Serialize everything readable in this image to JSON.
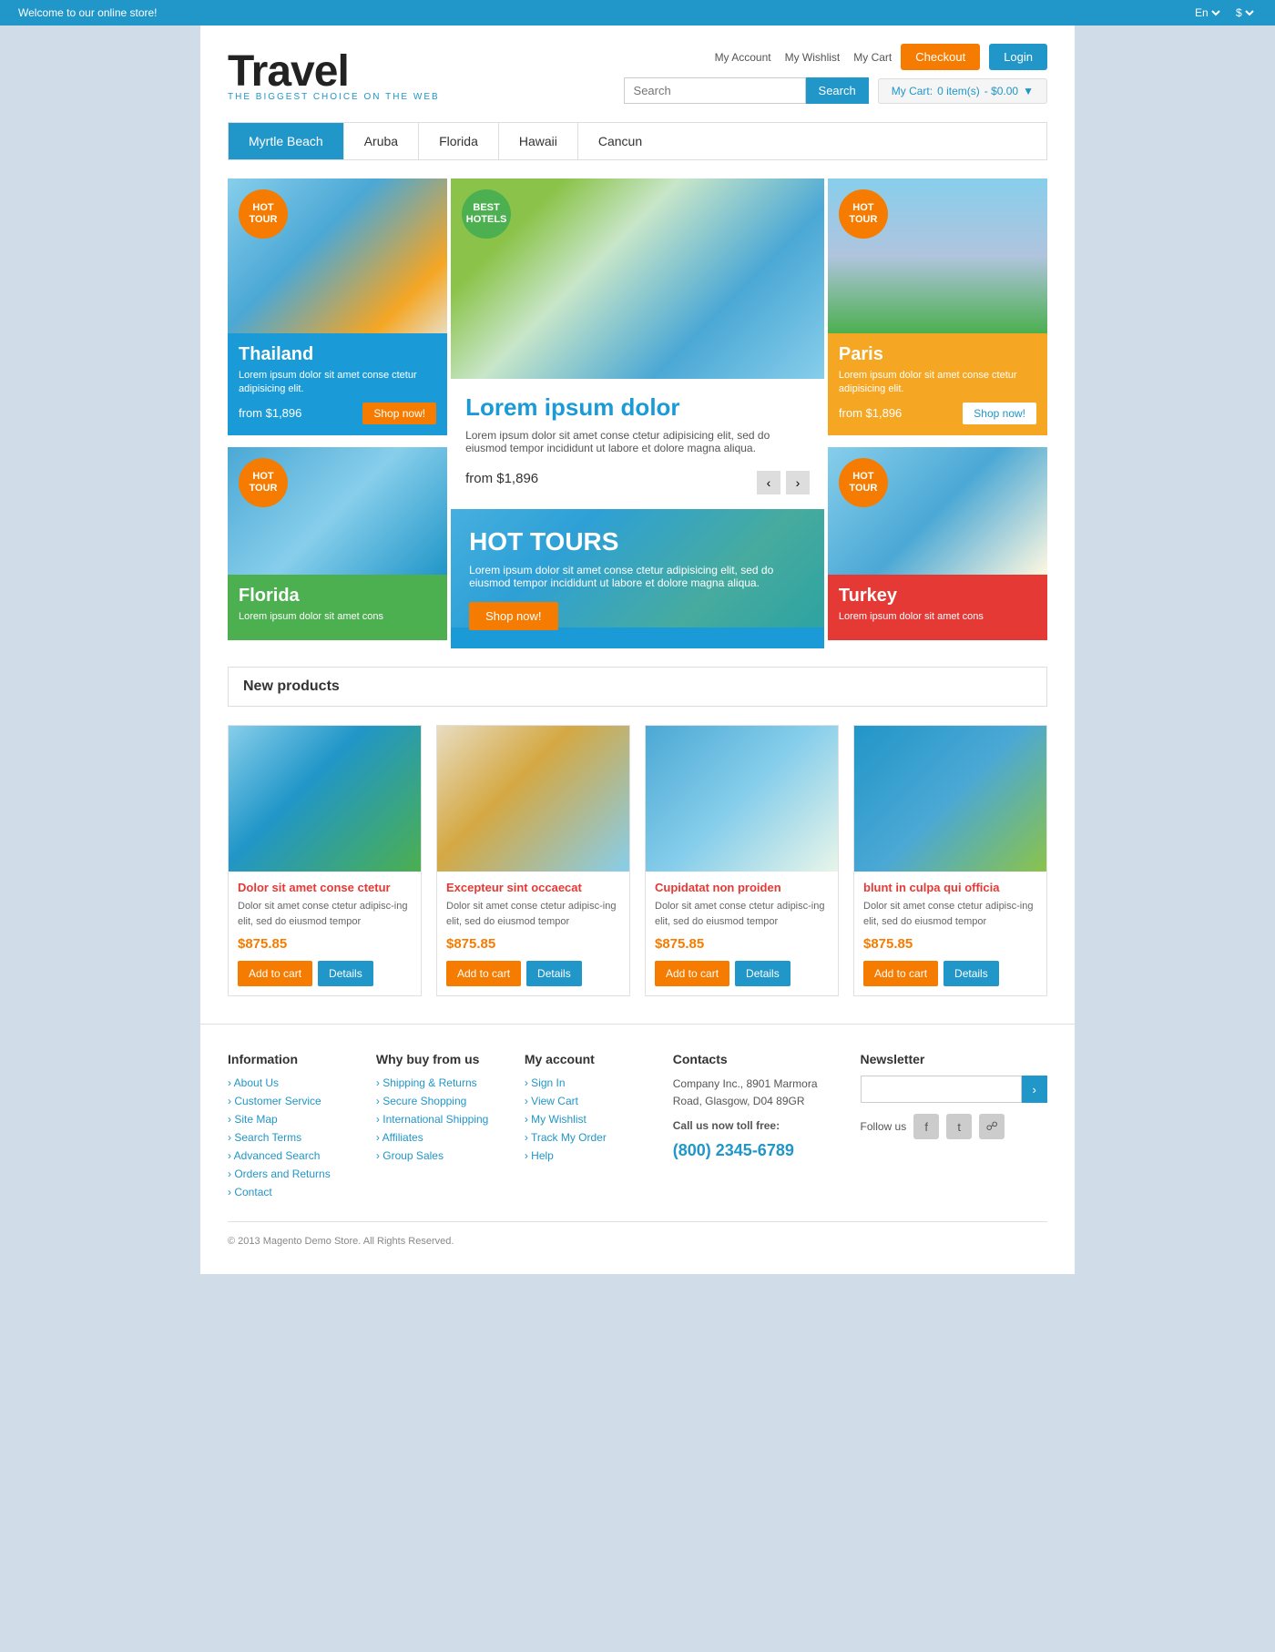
{
  "topbar": {
    "welcome": "Welcome to our online store!",
    "lang": "En",
    "currency": "$"
  },
  "header": {
    "logo_title": "Travel",
    "logo_subtitle": "THE BIGGEST CHOICE ON THE WEB",
    "nav": [
      "My Account",
      "My Wishlist",
      "My Cart"
    ],
    "checkout_label": "Checkout",
    "login_label": "Login",
    "search_placeholder": "Search",
    "search_btn": "Search",
    "cart_label": "My Cart:",
    "cart_items": "0 item(s)",
    "cart_total": "- $0.00"
  },
  "nav_tabs": [
    {
      "label": "Myrtle Beach",
      "active": true
    },
    {
      "label": "Aruba",
      "active": false
    },
    {
      "label": "Florida",
      "active": false
    },
    {
      "label": "Hawaii",
      "active": false
    },
    {
      "label": "Cancun",
      "active": false
    }
  ],
  "banners": {
    "thailand": {
      "badge": "HOT TOUR",
      "title": "Thailand",
      "desc": "Lorem ipsum dolor sit amet conse ctetur adipisicing elit.",
      "price": "from $1,896",
      "shop_btn": "Shop now!"
    },
    "hotels": {
      "badge": "BEST HOTELS",
      "badge_color": "green",
      "title": "Lorem ipsum dolor",
      "desc": "Lorem ipsum dolor sit amet conse ctetur adipisicing elit, sed do eiusmod tempor incididunt ut labore et dolore magna aliqua.",
      "price": "from $1,896"
    },
    "paris": {
      "badge": "HOT TOUR",
      "title": "Paris",
      "desc": "Lorem ipsum dolor sit amet conse ctetur adipisicing elit.",
      "price": "from $1,896",
      "shop_btn": "Shop now!"
    },
    "florida": {
      "badge": "HOT TOUR",
      "title": "Florida",
      "desc": "Lorem ipsum dolor sit amet cons"
    },
    "hot_tours": {
      "title": "HOT TOURS",
      "desc": "Lorem ipsum dolor sit amet conse ctetur adipisicing elit, sed do eiusmod tempor incididunt ut labore et dolore magna aliqua.",
      "btn": "Shop now!"
    },
    "turkey": {
      "badge": "HOT TOUR",
      "title": "Turkey",
      "desc": "Lorem ipsum dolor sit amet cons"
    }
  },
  "new_products": {
    "section_title": "New products",
    "items": [
      {
        "name": "Dolor sit amet conse ctetur",
        "desc": "Dolor sit amet conse ctetur adipisc-ing elit, sed do eiusmod tempor",
        "price": "$875.85",
        "add_cart": "Add to cart",
        "details": "Details"
      },
      {
        "name": "Excepteur sint occaecat",
        "desc": "Dolor sit amet conse ctetur adipisc-ing elit, sed do eiusmod tempor",
        "price": "$875.85",
        "add_cart": "Add to cart",
        "details": "Details"
      },
      {
        "name": "Cupidatat non proiden",
        "desc": "Dolor sit amet conse ctetur adipisc-ing elit, sed do eiusmod tempor",
        "price": "$875.85",
        "add_cart": "Add to cart",
        "details": "Details"
      },
      {
        "name": "blunt in culpa qui officia",
        "desc": "Dolor sit amet conse ctetur adipisc-ing elit, sed do eiusmod tempor",
        "price": "$875.85",
        "add_cart": "Add to cart",
        "details": "Details"
      }
    ]
  },
  "footer": {
    "information": {
      "title": "Information",
      "links": [
        "About Us",
        "Customer Service",
        "Site Map",
        "Search Terms",
        "Advanced Search",
        "Orders and Returns",
        "Contact"
      ]
    },
    "why_us": {
      "title": "Why buy from us",
      "links": [
        "Shipping & Returns",
        "Secure Shopping",
        "International Shipping",
        "Affiliates",
        "Group Sales"
      ]
    },
    "my_account": {
      "title": "My account",
      "links": [
        "Sign In",
        "View Cart",
        "My Wishlist",
        "Track My Order",
        "Help"
      ]
    },
    "contacts": {
      "title": "Contacts",
      "address": "Company Inc., 8901 Marmora Road, Glasgow, D04 89GR",
      "toll_free": "Call us now toll free:",
      "phone": "(800) 2345-6789"
    },
    "newsletter": {
      "title": "Newsletter",
      "placeholder": "",
      "follow": "Follow us"
    },
    "copyright": "© 2013 Magento Demo Store. All Rights Reserved."
  }
}
